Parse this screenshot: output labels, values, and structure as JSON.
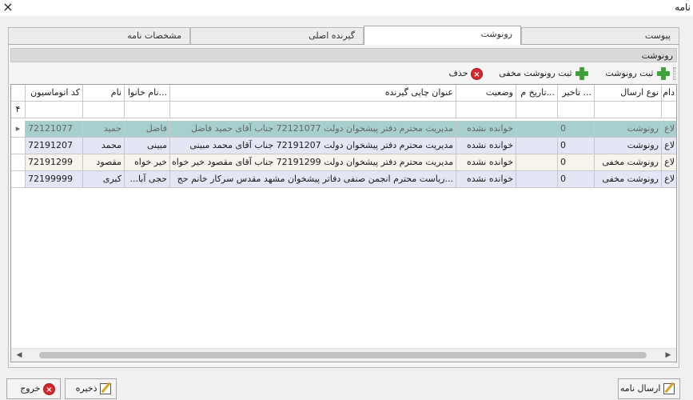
{
  "window": {
    "title": "نامه",
    "close_glyph": "×"
  },
  "tabs": [
    {
      "label": "مشخصات نامه",
      "active": false
    },
    {
      "label": "گیرنده اصلی",
      "active": false
    },
    {
      "label": "رونوشت",
      "active": true
    },
    {
      "label": "پیوست",
      "active": false
    }
  ],
  "group": {
    "title": "رونوشت"
  },
  "toolbar": {
    "add_copy": "ثبت رونوشت",
    "add_hidden_copy": "ثبت رونوشت مخفی",
    "delete": "حذف"
  },
  "grid": {
    "columns": {
      "code": "کد اتوماسیون",
      "first_name": "نام",
      "last_name": "...نام خانوا",
      "print_title": "عنوان چاپی گیرنده",
      "status": "وضعیت",
      "date": "...تاریخ م",
      "delay": "... تاخیر",
      "send_type": "نوع ارسال",
      "last": "دام"
    },
    "filter_marker": "۴",
    "rows": [
      {
        "code": "72121077",
        "first_name": "حمید",
        "last_name": "فاضل",
        "print_title": "مدیریت محترم دفتر پیشخوان دولت 72121077 جناب آقای حمید فاضل",
        "status": "خوانده نشده",
        "date": "",
        "delay": "0",
        "send_type": "رونوشت",
        "last": "لاع"
      },
      {
        "code": "72191207",
        "first_name": "محمد",
        "last_name": "مبینی",
        "print_title": "مدیریت محترم دفتر پیشخوان دولت 72191207 جناب آقای محمد مبینی",
        "status": "خوانده نشده",
        "date": "",
        "delay": "0",
        "send_type": "رونوشت",
        "last": "لاع"
      },
      {
        "code": "72191299",
        "first_name": "مقصود",
        "last_name": "خیر خواه",
        "print_title": "مدیریت محترم دفتر پیشخوان دولت 72191299 جناب آقای مقصود خیر خواه",
        "status": "خوانده نشده",
        "date": "",
        "delay": "0",
        "send_type": "رونوشت مخفی",
        "last": "لاع"
      },
      {
        "code": "72199999",
        "first_name": "کبری",
        "last_name": "حجی آبا...",
        "print_title": "...ریاست محترم انجمن صنفی دفاتر پیشخوان مشهد مقدس سرکار خانم حج",
        "status": "خوانده نشده",
        "date": "",
        "delay": "0",
        "send_type": "رونوشت مخفی",
        "last": "لاع"
      }
    ]
  },
  "footer": {
    "send_letter": "ارسال نامه",
    "save": "ذخیره",
    "exit": "خروج"
  }
}
